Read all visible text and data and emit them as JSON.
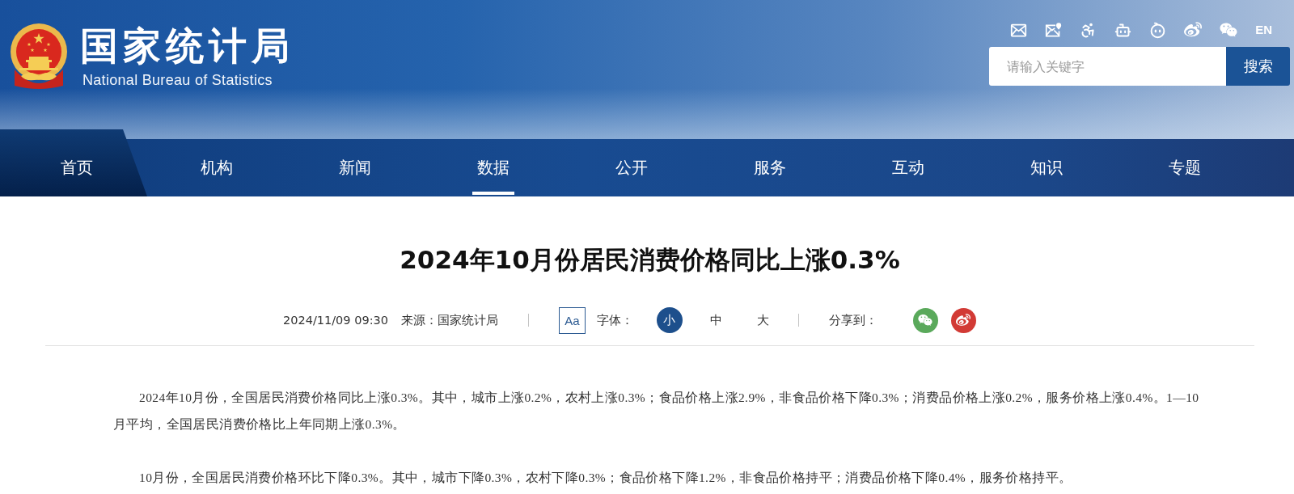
{
  "header": {
    "title": "国家统计局",
    "subtitle": "National Bureau of Statistics",
    "language": "EN",
    "search": {
      "placeholder": "请输入关键字",
      "button": "搜索"
    }
  },
  "nav": [
    {
      "label": "首页",
      "kind": "home",
      "selected": false
    },
    {
      "label": "机构",
      "kind": "link",
      "selected": false
    },
    {
      "label": "新闻",
      "kind": "link",
      "selected": false
    },
    {
      "label": "数据",
      "kind": "link",
      "selected": true
    },
    {
      "label": "公开",
      "kind": "link",
      "selected": false
    },
    {
      "label": "服务",
      "kind": "link",
      "selected": false
    },
    {
      "label": "互动",
      "kind": "link",
      "selected": false
    },
    {
      "label": "知识",
      "kind": "link",
      "selected": false
    },
    {
      "label": "专题",
      "kind": "link",
      "selected": false
    }
  ],
  "article": {
    "title": "2024年10月份居民消费价格同比上涨0.3%",
    "date": "2024/11/09 09:30",
    "source": "来源：国家统计局",
    "font_badge": "Aa",
    "font_label": "字体：",
    "font_sizes": [
      {
        "label": "小",
        "selected": true
      },
      {
        "label": "中",
        "selected": false
      },
      {
        "label": "大",
        "selected": false
      }
    ],
    "share_label": "分享到：",
    "paragraphs": [
      "2024年10月份，全国居民消费价格同比上涨0.3%。其中，城市上涨0.2%，农村上涨0.3%；食品价格上涨2.9%，非食品价格下降0.3%；消费品价格上涨0.2%，服务价格上涨0.4%。1—10月平均，全国居民消费价格比上年同期上涨0.3%。",
      "10月份，全国居民消费价格环比下降0.3%。其中，城市下降0.3%，农村下降0.3%；食品价格下降1.2%，非食品价格持平；消费品价格下降0.4%，服务价格持平。"
    ]
  }
}
